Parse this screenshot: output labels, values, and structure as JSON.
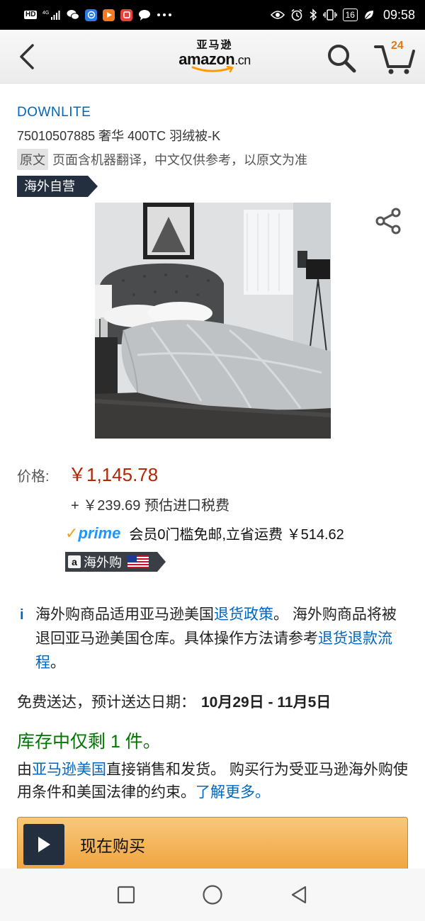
{
  "status_bar": {
    "hd": "HD",
    "network": "4G",
    "battery": "16",
    "time": "09:58",
    "left_icons": [
      "hd-icon",
      "signal-icon",
      "wechat-icon",
      "message-app-icon",
      "video-app-icon",
      "red-app-icon",
      "chat-bubble-icon",
      "more-dots-icon"
    ],
    "right_icons": [
      "eye-icon",
      "alarm-icon",
      "bluetooth-icon",
      "vibrate-icon",
      "battery-icon",
      "leaf-icon"
    ]
  },
  "header": {
    "logo_cn": "亚马逊",
    "logo_en": "amazon",
    "logo_suffix": ".cn",
    "cart_count": "24",
    "icons": [
      "back-chevron-icon",
      "search-icon",
      "cart-icon"
    ]
  },
  "product": {
    "brand": "DOWNLITE",
    "title": "75010507885 奢华 400TC 羽绒被-K",
    "translate_badge": "原文",
    "translate_note": "页面含机器翻译，中文仅供参考，以原文为准",
    "overseas_tag": "海外自营",
    "image_alt": "grey down comforter on bed"
  },
  "pricing": {
    "price_label": "价格:",
    "price": "￥1,145.78",
    "tax": "+ ￥239.69 预估进口税费",
    "prime_check": "✓",
    "prime_label": "prime",
    "prime_text": "会员0门槛免邮,立省运费 ￥514.62",
    "hwg_a": "a",
    "hwg_label": "海外购"
  },
  "policy": {
    "info": "i",
    "text1": "海外购商品适用亚马逊美国",
    "link1": "退货政策",
    "text2": "。 海外购商品将被退回亚马逊美国仓库。具体操作方法请参考",
    "link2": "退货退款流程",
    "text3": "。"
  },
  "delivery": {
    "label": "免费送达，预计送达日期：",
    "dates": "10月29日 - 11月5日"
  },
  "stock": "库存中仅剩 1 件。",
  "seller": {
    "prefix": "由",
    "link1": "亚马逊美国",
    "text": "直接销售和发货。 购买行为受亚马逊海外购使用条件和美国法律的约束。",
    "link2": "了解更多。"
  },
  "buy_button": "现在购买",
  "nav": [
    "recent-apps-icon",
    "home-icon",
    "back-triangle-icon"
  ],
  "colors": {
    "price": "#b12704",
    "link": "#0066c0",
    "stock": "#007600",
    "buy_button": "#f0a33c",
    "prime": "#1a98ff",
    "dark_tag": "#232f3e"
  }
}
